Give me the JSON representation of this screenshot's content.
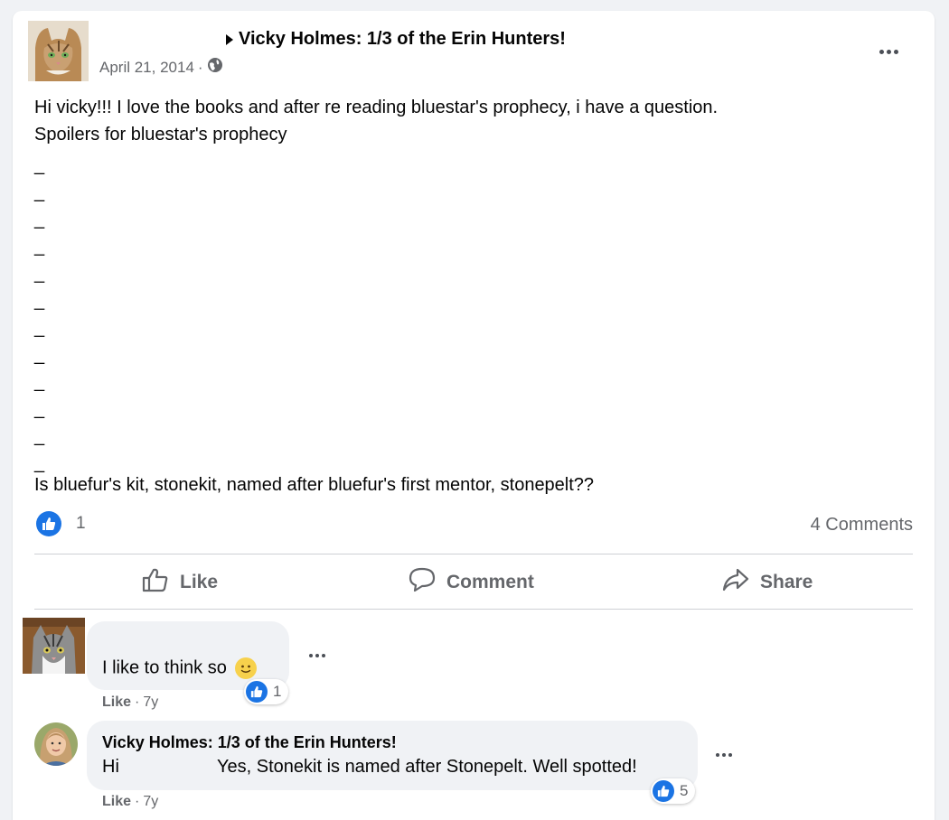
{
  "post": {
    "author": "Vicky Holmes: 1/3 of the Erin Hunters!",
    "date": "April 21, 2014",
    "separator": "·",
    "privacy_icon": "globe-icon",
    "body_line1": "Hi vicky!!! I love the books and after re reading bluestar's prophecy, i have a question.",
    "body_line2": "Spoilers for bluestar's prophecy",
    "spacer_dashes": [
      "_",
      "_",
      "_",
      "_",
      "_",
      "_",
      "_",
      "_",
      "_",
      "_",
      "_",
      "_"
    ],
    "question": "Is bluefur's kit, stonekit, named after bluefur's first mentor, stonepelt??",
    "like_count": "1",
    "comments_label": "4 Comments"
  },
  "actions": {
    "like": "Like",
    "comment": "Comment",
    "share": "Share"
  },
  "comments": [
    {
      "author": "",
      "text": "I like to think so",
      "emoji": "slightly-smiling-face",
      "like_label": "Like",
      "age": "7y",
      "reactions": "1"
    },
    {
      "author": "Vicky Holmes: 1/3 of the Erin Hunters!",
      "greeting": "Hi",
      "text": "Yes, Stonekit is named after Stonepelt. Well spotted!",
      "like_label": "Like",
      "age": "7y",
      "reactions": "5"
    }
  ],
  "colors": {
    "accent": "#1b74e4",
    "muted_text": "#65676b",
    "bubble": "#f0f2f5"
  }
}
